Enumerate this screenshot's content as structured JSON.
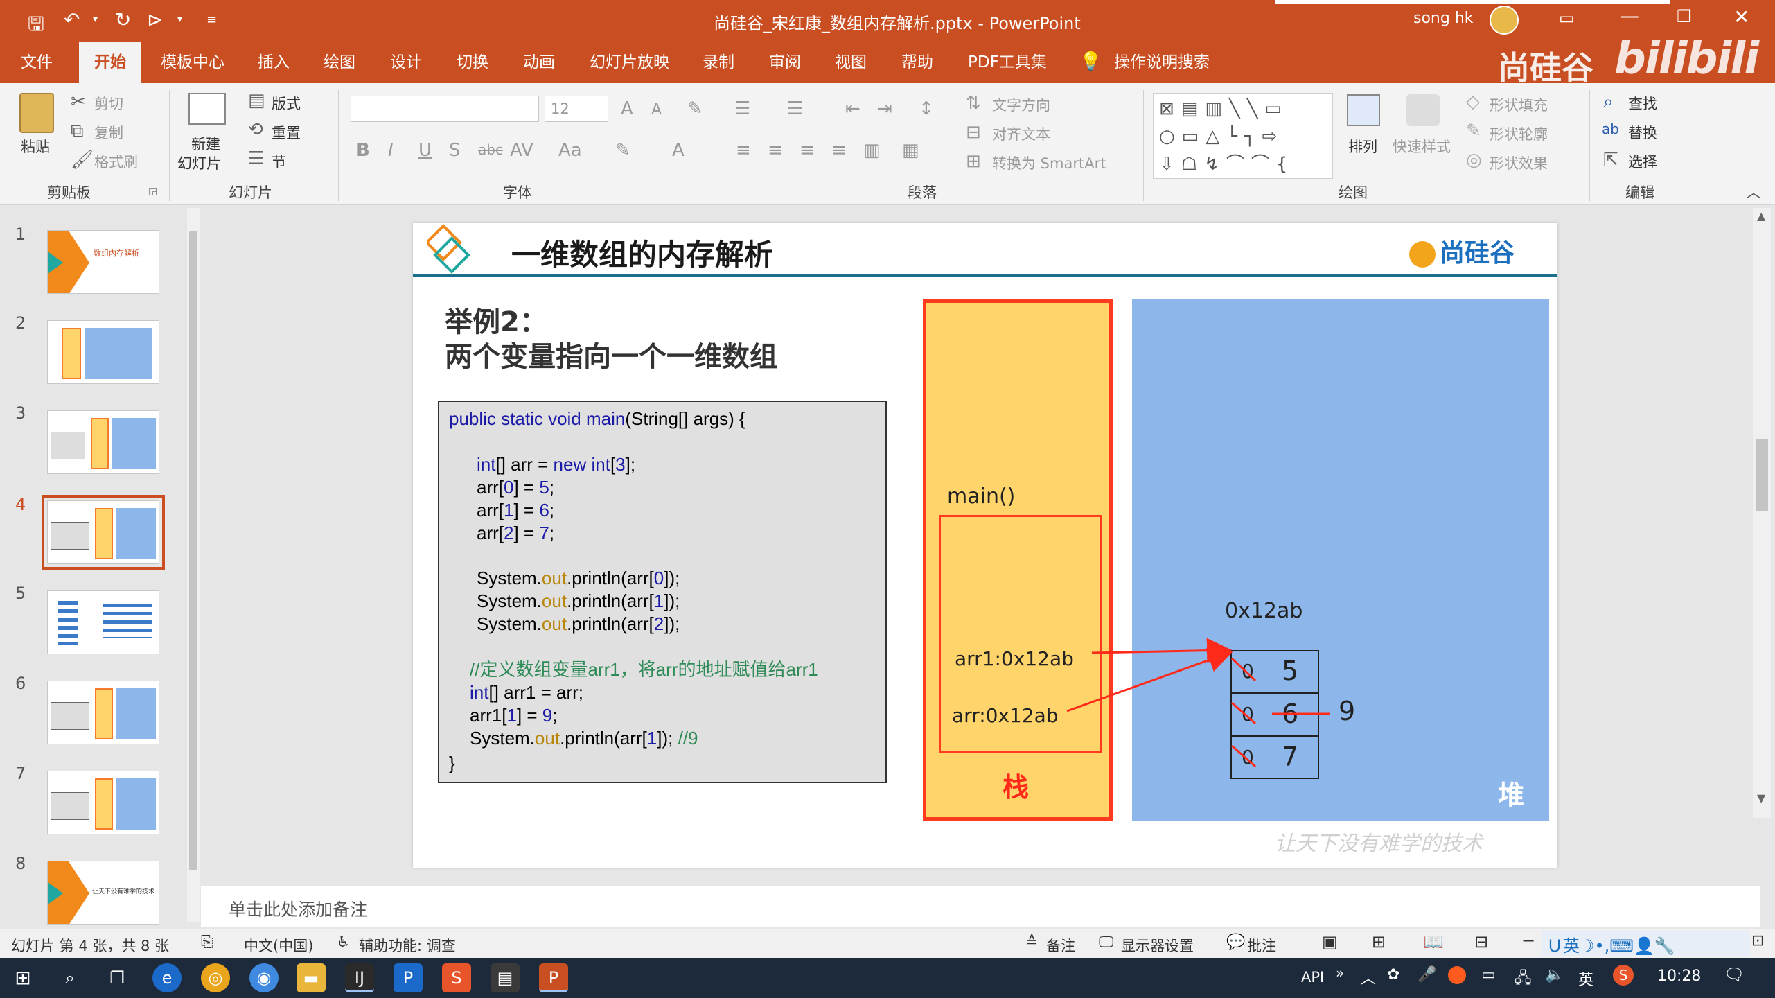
{
  "window": {
    "title": "尚硅谷_宋红康_数组内存解析.pptx  -  PowerPoint",
    "user": "song hk",
    "watermark_brand": "尚硅谷",
    "bilibili": "bilibili"
  },
  "ribbon_tabs": [
    "文件",
    "开始",
    "模板中心",
    "插入",
    "绘图",
    "设计",
    "切换",
    "动画",
    "幻灯片放映",
    "录制",
    "审阅",
    "视图",
    "帮助",
    "PDF工具集"
  ],
  "tell_me": "操作说明搜索",
  "ribbon": {
    "clipboard": {
      "paste": "粘贴",
      "cut": "剪切",
      "copy": "复制",
      "format_painter": "格式刷",
      "group": "剪贴板"
    },
    "slides": {
      "new_slide_1": "新建",
      "new_slide_2": "幻灯片",
      "layout": "版式",
      "reset": "重置",
      "section": "节",
      "group": "幻灯片"
    },
    "font": {
      "size": "12",
      "group": "字体"
    },
    "paragraph": {
      "text_direction": "文字方向",
      "align_text": "对齐文本",
      "smartart": "转换为 SmartArt",
      "group": "段落"
    },
    "drawing": {
      "arrange": "排列",
      "quick_styles": "快速样式",
      "shape_fill": "形状填充",
      "shape_outline": "形状轮廓",
      "shape_effects": "形状效果",
      "group": "绘图"
    },
    "editing": {
      "find": "查找",
      "replace": "替换",
      "select": "选择",
      "group": "编辑"
    }
  },
  "thumbnails": [
    {
      "num": "1",
      "label": "数组内存解析"
    },
    {
      "num": "2",
      "label": ""
    },
    {
      "num": "3",
      "label": ""
    },
    {
      "num": "4",
      "label": ""
    },
    {
      "num": "5",
      "label": ""
    },
    {
      "num": "6",
      "label": ""
    },
    {
      "num": "7",
      "label": ""
    },
    {
      "num": "8",
      "label": "让天下没有难学的技术"
    }
  ],
  "slide": {
    "title": "一维数组的内存解析",
    "logo": "尚硅谷",
    "example_line1": "举例2：",
    "example_line2": "两个变量指向一个一维数组",
    "code": {
      "l1a": "public static void ",
      "l1b": "main",
      "l1c": "(String[] args) {",
      "l2a": "int",
      "l2b": "[] arr = ",
      "l2c": "new int",
      "l2d": "[",
      "l2e": "3",
      "l2f": "];",
      "l3a": "arr[",
      "l3b": "0",
      "l3c": "] = ",
      "l3d": "5",
      "l3e": ";",
      "l4b": "1",
      "l4d": "6",
      "l5b": "2",
      "l5d": "7",
      "p_a": "System.",
      "p_b": "out",
      "p_c": ".println(arr[",
      "p0": "0",
      "p1": "1",
      "p2": "2",
      "p_d": "]);",
      "comment": "//定义数组变量arr1，将arr的地址赋值给arr1",
      "l10a": "int",
      "l10b": "[] arr1 = arr;",
      "l11a": "arr1[",
      "l11b": "1",
      "l11c": "] = ",
      "l11d": "9",
      "l11e": ";",
      "l12c": "]); ",
      "l12d": "//9",
      "close": "}"
    },
    "stack": {
      "frame": "main()",
      "var1": "arr1:0x12ab",
      "var2": "arr:0x12ab",
      "label": "栈"
    },
    "heap": {
      "address": "0x12ab",
      "label": "堆",
      "cells": [
        {
          "old": "0",
          "value": "5"
        },
        {
          "old": "0",
          "value": "6"
        },
        {
          "old": "0",
          "value": "7"
        }
      ],
      "new_value": "9"
    },
    "motto": "让天下没有难学的技术"
  },
  "notes_placeholder": "单击此处添加备注",
  "status": {
    "slide_info": "幻灯片 第 4 张，共 8 张",
    "language": "中文(中国)",
    "accessibility": "辅助功能: 调查",
    "notes": "备注",
    "display": "显示器设置",
    "comments": "批注"
  },
  "taskbar": {
    "api": "API",
    "ime": "英",
    "time": "10:28"
  },
  "colors": {
    "accent": "#c94f22",
    "stack": "#ffd56b",
    "heap": "#8db7ea",
    "arrow": "#ff2a1a"
  }
}
